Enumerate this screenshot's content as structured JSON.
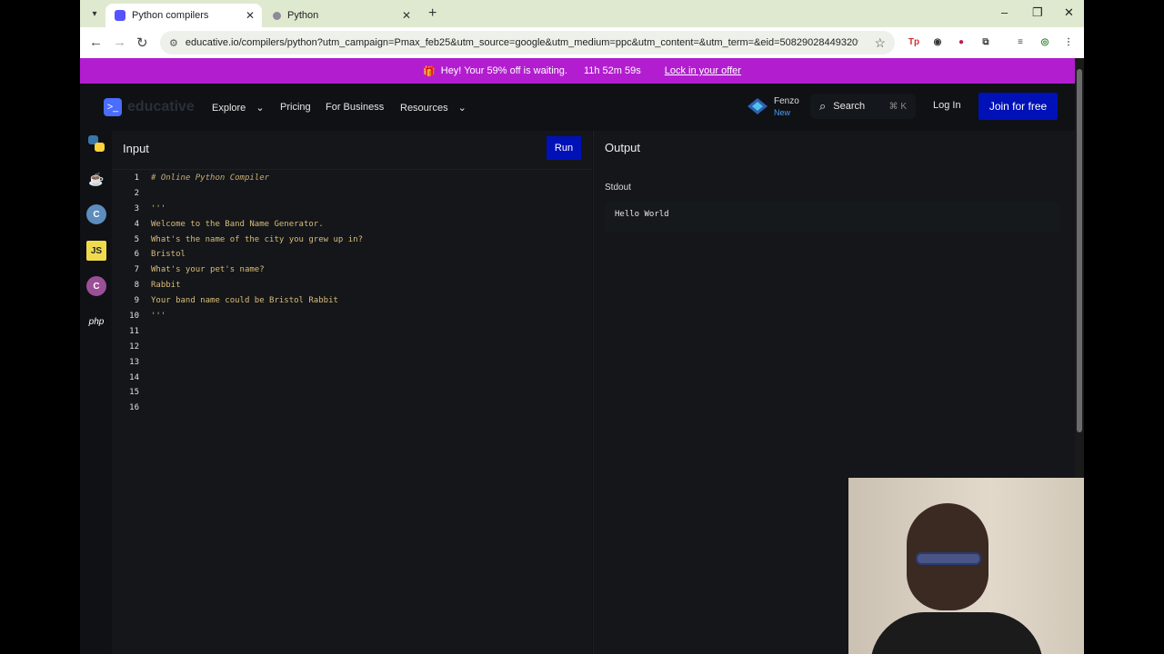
{
  "browser": {
    "tabs": [
      {
        "title": "Python compilers",
        "active": true
      },
      {
        "title": "Python",
        "active": false
      }
    ],
    "url": "educative.io/compilers/python?utm_campaign=Pmax_feb25&utm_source=google&utm_medium=ppc&utm_content=&utm_term=&eid=5082902844932096&utm...",
    "window_controls": {
      "minimize": "–",
      "restore": "❐",
      "close": "✕"
    }
  },
  "promo": {
    "text": "Hey! Your 59% off is waiting.",
    "timer": "11h 52m 59s",
    "link": "Lock in your offer",
    "color": "#b21ecf"
  },
  "header": {
    "logo_text": "educative",
    "nav": [
      "Explore",
      "Pricing",
      "For Business",
      "Resources"
    ],
    "fenzo": {
      "name": "Fenzo",
      "badge": "New"
    },
    "search": {
      "label": "Search",
      "shortcut": "⌘ K"
    },
    "login": "Log In",
    "join": "Join for free",
    "accent": "#0011b8"
  },
  "languages": [
    {
      "icon": "python-icon",
      "label": ""
    },
    {
      "icon": "java-icon",
      "label": ""
    },
    {
      "icon": "c-icon",
      "label": "C"
    },
    {
      "icon": "javascript-icon",
      "label": "JS"
    },
    {
      "icon": "csharp-icon",
      "label": "C"
    },
    {
      "icon": "php-icon",
      "label": "php"
    }
  ],
  "input": {
    "title": "Input",
    "run_label": "Run",
    "lines": [
      "# Online Python Compiler",
      "",
      "'''",
      "Welcome to the Band Name Generator.",
      "What's the name of the city you grew up in?",
      "Bristol",
      "What's your pet's name?",
      "Rabbit",
      "Your band name could be Bristol Rabbit",
      "'''",
      "",
      "",
      "",
      "",
      "",
      ""
    ]
  },
  "output": {
    "title": "Output",
    "stdout_label": "Stdout",
    "stdout": "Hello World"
  }
}
